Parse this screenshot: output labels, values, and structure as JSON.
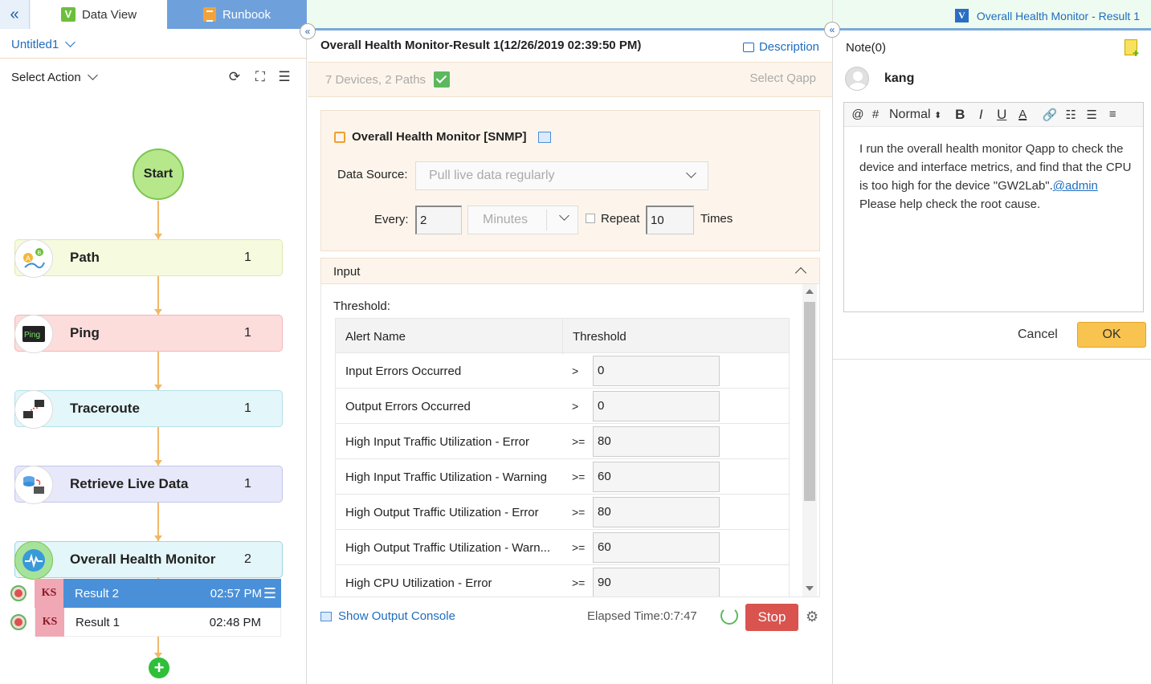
{
  "left": {
    "collapse_icon": "double-chevron-left-icon",
    "tabs": [
      {
        "label": "Data View",
        "icon": "data-view-logo-icon",
        "active": false
      },
      {
        "label": "Runbook",
        "icon": "runbook-notebook-icon",
        "active": true
      }
    ],
    "runbook_name": "Untitled1",
    "select_action": "Select Action",
    "toolbar_icons": [
      "refresh-icon",
      "fit-screen-icon",
      "menu-icon"
    ],
    "start_label": "Start",
    "nodes": [
      {
        "label": "Path",
        "count": "1",
        "icon": "path-ab-icon",
        "bg": "#f6fadf",
        "border": "#dfe8b0"
      },
      {
        "label": "Ping",
        "count": "1",
        "icon": "ping-icon",
        "bg": "#fddcdc",
        "border": "#f0b8b8"
      },
      {
        "label": "Traceroute",
        "count": "1",
        "icon": "traceroute-icon",
        "bg": "#e3f6f9",
        "border": "#b5e0e8"
      },
      {
        "label": "Retrieve Live Data",
        "count": "1",
        "icon": "retrieve-live-data-icon",
        "bg": "#e7e8f9",
        "border": "#c2c6ee"
      },
      {
        "label": "Overall Health Monitor",
        "count": "2",
        "icon": "health-monitor-icon",
        "bg": "#e3f6f9",
        "border": "#9fd6e4"
      }
    ],
    "results": [
      {
        "badge": "KS",
        "name": "Result 2",
        "time": "02:57 PM",
        "selected": true
      },
      {
        "badge": "KS",
        "name": "Result 1",
        "time": "02:48 PM",
        "selected": false
      }
    ]
  },
  "middle": {
    "title": "Overall Health Monitor-Result 1(12/26/2019 02:39:50 PM)",
    "description_label": "Description",
    "devices_paths": "7 Devices, 2 Paths",
    "select_qapp": "Select Qapp",
    "qapp_title": "Overall Health Monitor [SNMP]",
    "data_source_label": "Data Source:",
    "data_source_value": "Pull live data regularly",
    "every_label": "Every:",
    "every_value": "2",
    "every_unit": "Minutes",
    "repeat_label": "Repeat",
    "repeat_times": "10",
    "times_label": "Times",
    "input_section": "Input",
    "threshold_label": "Threshold:",
    "table_headers": [
      "Alert Name",
      "Threshold"
    ],
    "rows": [
      {
        "name": "Input Errors Occurred",
        "op": ">",
        "value": "0"
      },
      {
        "name": "Output Errors Occurred",
        "op": ">",
        "value": "0"
      },
      {
        "name": "High Input Traffic Utilization - Error",
        "op": ">=",
        "value": "80"
      },
      {
        "name": "High Input Traffic Utilization - Warning",
        "op": ">=",
        "value": "60"
      },
      {
        "name": "High Output Traffic Utilization - Error",
        "op": ">=",
        "value": "80"
      },
      {
        "name": "High Output Traffic Utilization - Warn...",
        "op": ">=",
        "value": "60"
      },
      {
        "name": "High CPU Utilization - Error",
        "op": ">=",
        "value": "90"
      }
    ],
    "output_console": "Show Output Console",
    "elapsed": "Elapsed Time:0:7:47",
    "stop": "Stop"
  },
  "right": {
    "tab_title": "Overall Health Monitor - Result 1",
    "note_title": "Note(0)",
    "user": "kang",
    "toolbar": {
      "at": "@",
      "hash": "#",
      "format": "Normal",
      "bold": "B",
      "italic": "I",
      "underline": "U",
      "color": "A"
    },
    "note_text_1": "I run the overall health monitor Qapp to check the device and interface metrics, and find that the CPU is too high for the device \"GW2Lab\".",
    "note_mention": "@admin",
    "note_text_2": "  Please help check the root cause.",
    "cancel": "Cancel",
    "ok": "OK"
  },
  "colors": {
    "accent_blue": "#1f6dbf",
    "stop_red": "#d9534f",
    "ok_yellow": "#f8c44f",
    "selected_result": "#4a90d9"
  }
}
